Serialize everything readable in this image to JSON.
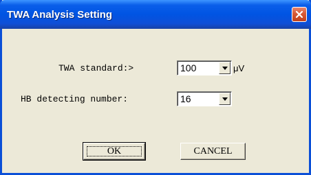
{
  "window": {
    "title": "TWA Analysis Setting"
  },
  "fields": {
    "twa_standard": {
      "label": "TWA standard:>",
      "value": "100",
      "unit": "μV"
    },
    "hb_detecting_number": {
      "label": "HB detecting number:",
      "value": "16"
    }
  },
  "buttons": {
    "ok_label": "OK",
    "cancel_label": "CANCEL"
  },
  "icons": {
    "close": "close-icon",
    "dropdown": "chevron-down-icon"
  },
  "colors": {
    "titlebar": "#0054e3",
    "window_face": "#ece9d8",
    "close_button": "#d65a36"
  }
}
